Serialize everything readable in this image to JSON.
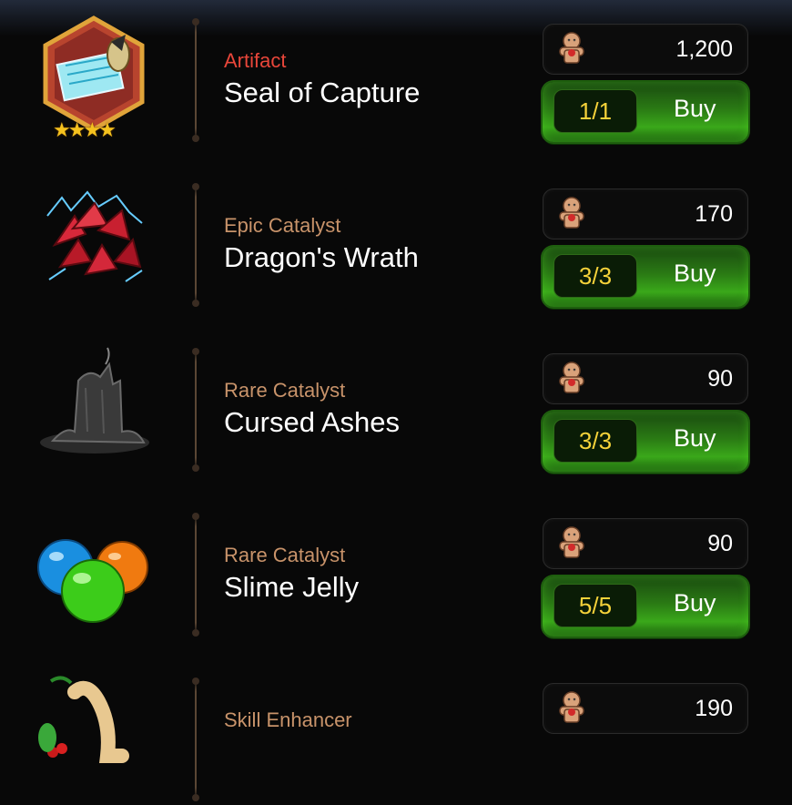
{
  "shop": {
    "items": [
      {
        "type": "Artifact",
        "name": "Seal of Capture",
        "price": "1,200",
        "stock": "1/1",
        "buy_label": "Buy",
        "stars": "★★★★",
        "icon": "seal-of-capture-icon"
      },
      {
        "type": "Epic Catalyst",
        "name": "Dragon's Wrath",
        "price": "170",
        "stock": "3/3",
        "buy_label": "Buy",
        "icon": "dragons-wrath-icon"
      },
      {
        "type": "Rare Catalyst",
        "name": "Cursed Ashes",
        "price": "90",
        "stock": "3/3",
        "buy_label": "Buy",
        "icon": "cursed-ashes-icon"
      },
      {
        "type": "Rare Catalyst",
        "name": "Slime Jelly",
        "price": "90",
        "stock": "5/5",
        "buy_label": "Buy",
        "icon": "slime-jelly-icon"
      },
      {
        "type": "Skill Enhancer",
        "price": "190",
        "icon": "ginseng-icon"
      }
    ],
    "currency_icon": "voodoo-doll-icon",
    "colors": {
      "artifact_type": "#e8463a",
      "catalyst_type": "#c8936a",
      "stock_text": "#f5d23a",
      "buy_button": "#2a7a14"
    }
  }
}
